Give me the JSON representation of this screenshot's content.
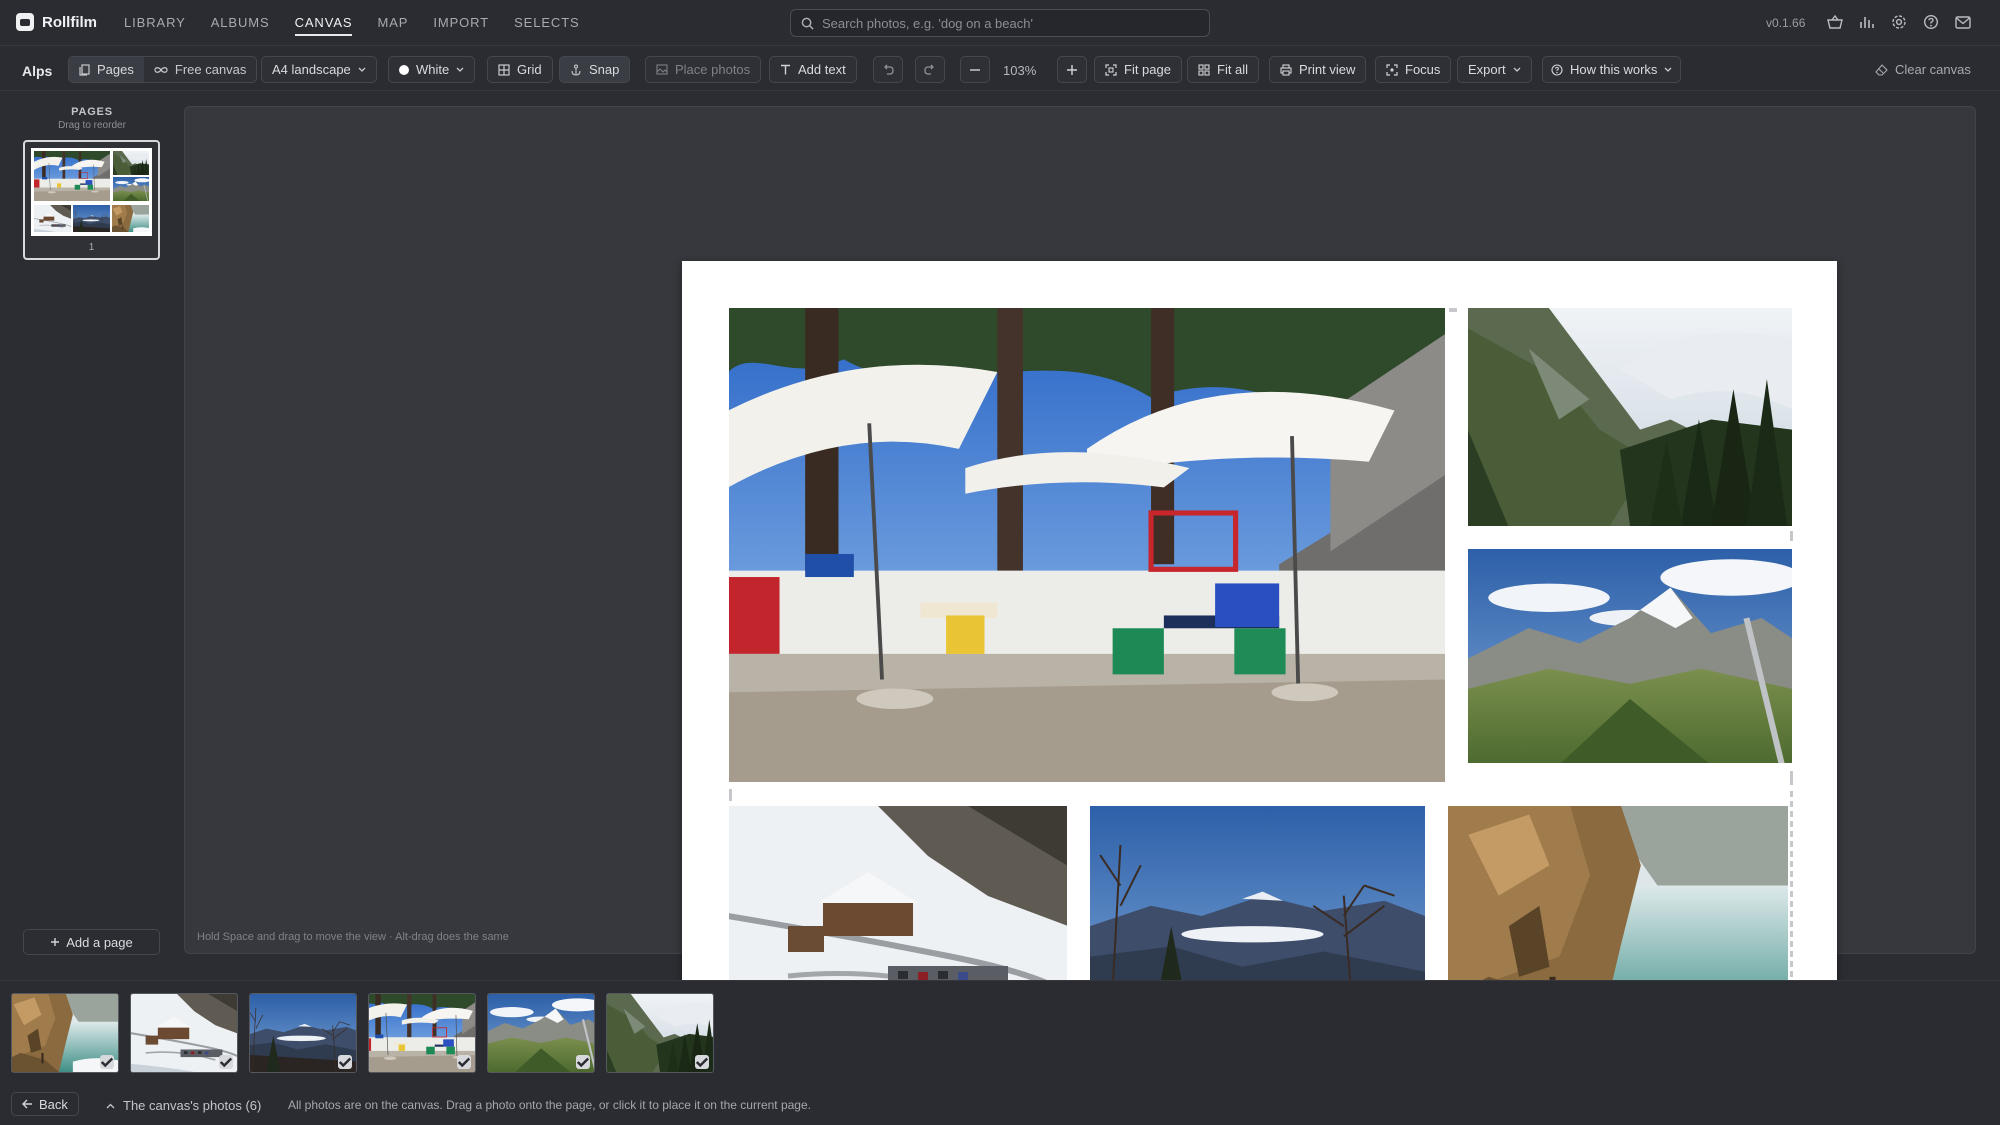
{
  "app": {
    "name": "Rollfilm",
    "version": "v0.1.66"
  },
  "nav": [
    {
      "label": "LIBRARY",
      "active": false
    },
    {
      "label": "ALBUMS",
      "active": false
    },
    {
      "label": "CANVAS",
      "active": true
    },
    {
      "label": "MAP",
      "active": false
    },
    {
      "label": "IMPORT",
      "active": false
    },
    {
      "label": "SELECTS",
      "active": false
    }
  ],
  "search": {
    "placeholder": "Search photos, e.g. 'dog on a beach'",
    "value": ""
  },
  "top_icons": [
    "basket-icon",
    "bar-chart-icon",
    "gear-icon",
    "help-icon",
    "mail-icon"
  ],
  "toolbar": {
    "doc_title": "Alps",
    "mode_pages": "Pages",
    "mode_free": "Free canvas",
    "page_size": "A4 landscape",
    "background": "White",
    "grid": "Grid",
    "snap": "Snap",
    "place_photos": "Place photos",
    "add_text": "Add text",
    "zoom": "103%",
    "fit_page": "Fit page",
    "fit_all": "Fit all",
    "print_view": "Print view",
    "focus": "Focus",
    "export": "Export",
    "how_this_works": "How this works",
    "clear_canvas": "Clear canvas"
  },
  "pages_panel": {
    "title": "PAGES",
    "subtitle": "Drag to reorder",
    "pages": [
      {
        "number": "1"
      }
    ],
    "add_page": "Add a page"
  },
  "canvas": {
    "hint": "Hold Space and drag to move the view · Alt-drag does the same",
    "photos": [
      {
        "name": "cafe-terrace",
        "subject": "cafe terrace with parasols"
      },
      {
        "name": "forest-valley",
        "subject": "forested valley with clouds"
      },
      {
        "name": "snowy-peaks",
        "subject": "snow-capped mountain peak"
      },
      {
        "name": "ski-lodge",
        "subject": "snowy ski lodge with parked cars"
      },
      {
        "name": "mountain-view",
        "subject": "mountain view with bare trees"
      },
      {
        "name": "lake-cliff",
        "subject": "lake reflection with rocky cliff"
      }
    ]
  },
  "strip": {
    "photos": [
      "lake-cliff",
      "ski-lodge",
      "mountain-view",
      "cafe-terrace",
      "snowy-peaks",
      "forest-valley"
    ],
    "collapse_label": "The canvas's photos (6)",
    "status": "All photos are on the canvas. Drag a photo onto the page, or click it to place it on the current page.",
    "back": "Back"
  },
  "colors": {
    "app_bg": "#2b2d32",
    "workspace": "#36383d",
    "page": "#ffffff"
  }
}
